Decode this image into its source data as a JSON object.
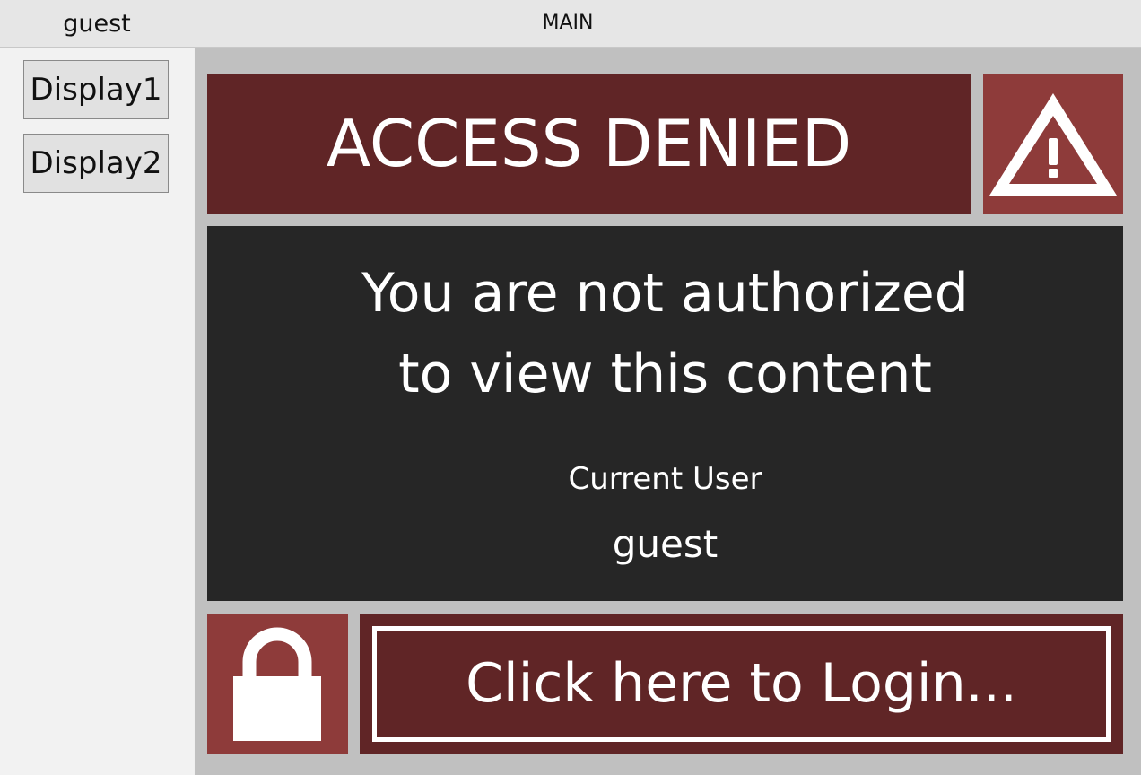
{
  "header": {
    "user": "guest",
    "title": "MAIN"
  },
  "sidebar": {
    "items": [
      {
        "label": "Display1"
      },
      {
        "label": "Display2"
      }
    ]
  },
  "banner": {
    "text": "ACCESS DENIED",
    "icon": "warning-triangle-icon"
  },
  "message": {
    "line1": "You are not authorized",
    "line2": "to view this content",
    "user_label": "Current User",
    "user_value": "guest"
  },
  "login": {
    "label": "Click here to Login...",
    "icon": "lock-icon"
  },
  "colors": {
    "banner_dark_red": "#602526",
    "tile_red": "#8e3b3a",
    "panel_dark": "#262626",
    "main_bg": "#c0c0c0"
  }
}
